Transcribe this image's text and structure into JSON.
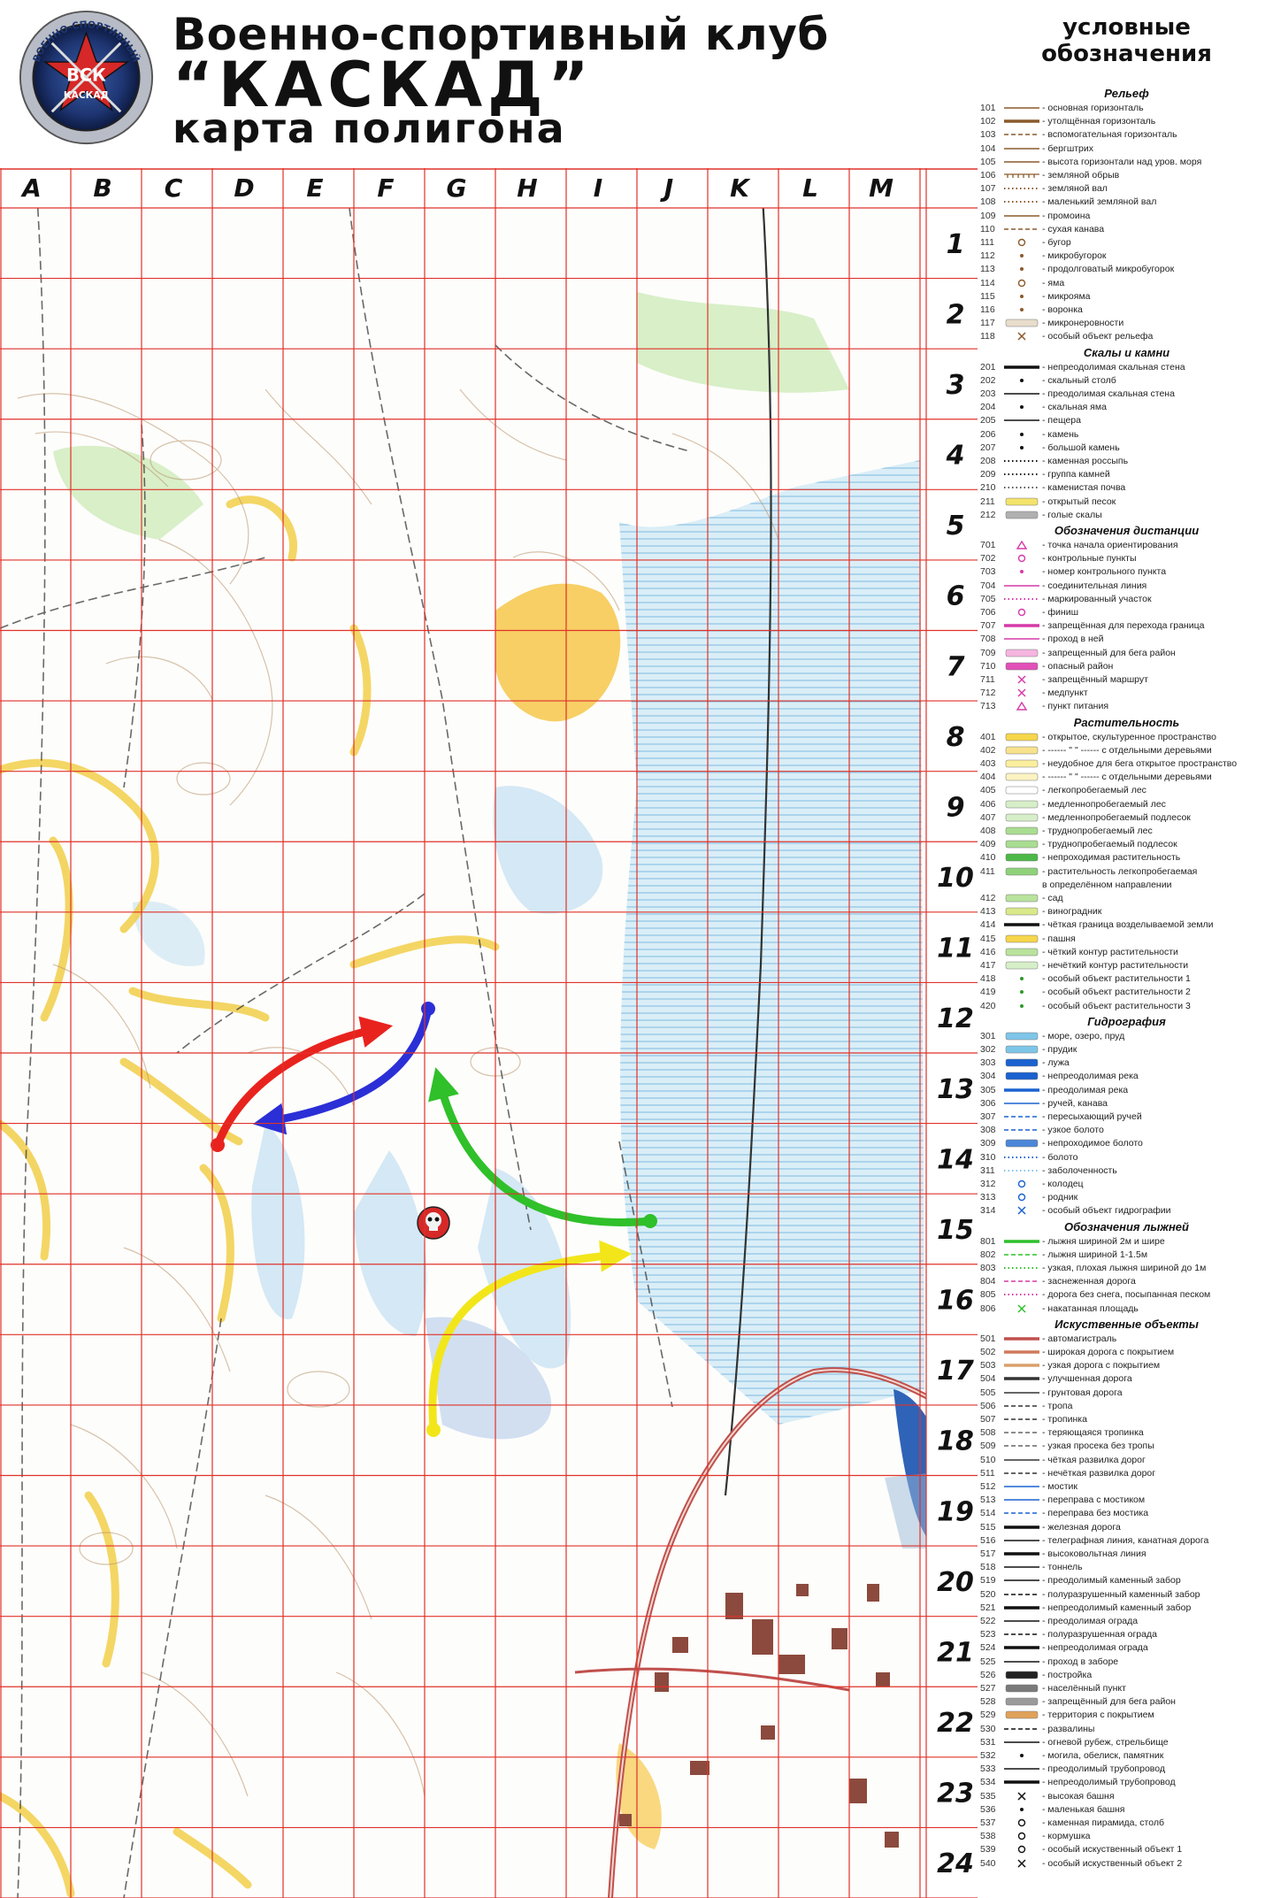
{
  "header": {
    "line1": "Военно-спортивный клуб",
    "line2": "“КАСКАД”",
    "line3": "карта полигона",
    "logo": {
      "top_text": "ВОЕННО-СПОРТИВНЫЙ",
      "abbr": "ВСК",
      "name": "КАСКАД"
    }
  },
  "grid": {
    "columns": [
      "A",
      "B",
      "C",
      "D",
      "E",
      "F",
      "G",
      "H",
      "I",
      "J",
      "K",
      "L",
      "M"
    ],
    "rows": [
      "1",
      "2",
      "3",
      "4",
      "5",
      "6",
      "7",
      "8",
      "9",
      "10",
      "11",
      "12",
      "13",
      "14",
      "15",
      "16",
      "17",
      "18",
      "19",
      "20",
      "21",
      "22",
      "23",
      "24"
    ]
  },
  "routes": [
    {
      "color": "#e8231e",
      "name": "red"
    },
    {
      "color": "#2b2fd6",
      "name": "blue"
    },
    {
      "color": "#2fc02a",
      "name": "green"
    },
    {
      "color": "#f2e61b",
      "name": "yellow"
    }
  ],
  "legend": {
    "title_line1": "условные",
    "title_line2": "обозначения",
    "sections": [
      {
        "title": "Рельеф",
        "items": [
          [
            "101",
            "основная горизонталь",
            "line",
            "#8a5a2b"
          ],
          [
            "102",
            "утолщённая горизонталь",
            "thick",
            "#8a5a2b"
          ],
          [
            "103",
            "вспомогательная горизонталь",
            "dash",
            "#8a5a2b"
          ],
          [
            "104",
            "бергштрих",
            "line",
            "#8a5a2b"
          ],
          [
            "105",
            "высота горизонтали над уров. моря",
            "line",
            "#8a5a2b"
          ],
          [
            "106",
            "земляной обрыв",
            "comb",
            "#8a5a2b"
          ],
          [
            "107",
            "земляной вал",
            "dots",
            "#8a5a2b"
          ],
          [
            "108",
            "маленький земляной вал",
            "dots",
            "#8a5a2b"
          ],
          [
            "109",
            "промоина",
            "line",
            "#8a5a2b"
          ],
          [
            "110",
            "сухая канава",
            "dash",
            "#8a5a2b"
          ],
          [
            "111",
            "бугор",
            "ring",
            "#8a5a2b"
          ],
          [
            "112",
            "микробугорок",
            "dot",
            "#8a5a2b"
          ],
          [
            "113",
            "продолговатый микробугорок",
            "dot",
            "#8a5a2b"
          ],
          [
            "114",
            "яма",
            "ring",
            "#8a5a2b"
          ],
          [
            "115",
            "микрояма",
            "dot",
            "#8a5a2b"
          ],
          [
            "116",
            "воронка",
            "dot",
            "#8a5a2b"
          ],
          [
            "117",
            "микронеровности",
            "fill",
            "#e8dccb"
          ],
          [
            "118",
            "особый объект рельефа",
            "cross",
            "#8a5a2b"
          ]
        ]
      },
      {
        "title": "Скалы и камни",
        "items": [
          [
            "201",
            "непреодолимая скальная стена",
            "thick",
            "#111111"
          ],
          [
            "202",
            "скальный столб",
            "dot",
            "#111111"
          ],
          [
            "203",
            "преодолимая скальная стена",
            "line",
            "#111111"
          ],
          [
            "204",
            "скальная яма",
            "dot",
            "#111111"
          ],
          [
            "205",
            "пещера",
            "line",
            "#111111"
          ],
          [
            "206",
            "камень",
            "dot",
            "#111111"
          ],
          [
            "207",
            "большой камень",
            "dot",
            "#111111"
          ],
          [
            "208",
            "каменная россыпь",
            "dots",
            "#111111"
          ],
          [
            "209",
            "группа камней",
            "dots",
            "#111111"
          ],
          [
            "210",
            "каменистая почва",
            "dots",
            "#555555"
          ],
          [
            "211",
            "открытый песок",
            "fill",
            "#f4e36a"
          ],
          [
            "212",
            "голые скалы",
            "fill",
            "#b0b0b0"
          ]
        ]
      },
      {
        "title": "Обозначения дистанции",
        "items": [
          [
            "701",
            "точка начала ориентирования",
            "tri",
            "#d63aa8"
          ],
          [
            "702",
            "контрольные пункты",
            "ring",
            "#d63aa8"
          ],
          [
            "703",
            "номер контрольного пункта",
            "dot",
            "#d63aa8"
          ],
          [
            "704",
            "соединительная линия",
            "line",
            "#d63aa8"
          ],
          [
            "705",
            "маркированный участок",
            "dots",
            "#d63aa8"
          ],
          [
            "706",
            "финиш",
            "ring",
            "#d63aa8"
          ],
          [
            "707",
            "запрещённая для перехода граница",
            "thick",
            "#d63aa8"
          ],
          [
            "708",
            "проход в ней",
            "line",
            "#d63aa8"
          ],
          [
            "709",
            "запрещенный для бега район",
            "fill",
            "#f5b5df"
          ],
          [
            "710",
            "опасный район",
            "fill",
            "#e24fb8"
          ],
          [
            "711",
            "запрещённый маршрут",
            "cross",
            "#d63aa8"
          ],
          [
            "712",
            "медпункт",
            "cross",
            "#d63aa8"
          ],
          [
            "713",
            "пункт питания",
            "tri",
            "#d63aa8"
          ]
        ]
      },
      {
        "title": "Растительность",
        "items": [
          [
            "401",
            "открытое, скультуренное пространство",
            "fill",
            "#f6d64a"
          ],
          [
            "402",
            "------ \" \" ------ с отдельными деревьями",
            "fill",
            "#f8e28c"
          ],
          [
            "403",
            "неудобное для бега открытое пространство",
            "fill",
            "#fbef9e"
          ],
          [
            "404",
            "------ \" \" ------ с отдельными деревьями",
            "fill",
            "#fcf3c2"
          ],
          [
            "405",
            "легкопробегаемый лес",
            "fill",
            "#ffffff"
          ],
          [
            "406",
            "медленнопробегаемый лес",
            "fill",
            "#d6efc9"
          ],
          [
            "407",
            "медленнопробегаемый подлесок",
            "fill",
            "#d6efc9"
          ],
          [
            "408",
            "труднопробегаемый лес",
            "fill",
            "#a9dd91"
          ],
          [
            "409",
            "труднопробегаемый подлесок",
            "fill",
            "#a9dd91"
          ],
          [
            "410",
            "непроходимая растительность",
            "fill",
            "#4cb847"
          ],
          [
            "411",
            "растительность легкопробегаемая",
            "fill",
            "#8fd27a"
          ],
          [
            "",
            "в определённом направлении",
            "none",
            ""
          ],
          [
            "412",
            "сад",
            "fill",
            "#b9e39d"
          ],
          [
            "413",
            "виноградник",
            "fill",
            "#d9e98a"
          ],
          [
            "414",
            "чёткая граница возделываемой земли",
            "thick",
            "#111111"
          ],
          [
            "415",
            "пашня",
            "fill",
            "#f6d64a"
          ],
          [
            "416",
            "чёткий контур растительности",
            "fill",
            "#b9e39d"
          ],
          [
            "417",
            "нечёткий контур растительности",
            "fill",
            "#d6efc9"
          ],
          [
            "418",
            "особый объект растительности 1",
            "dot",
            "#2f9a2a"
          ],
          [
            "419",
            "особый объект растительности 2",
            "dot",
            "#2f9a2a"
          ],
          [
            "420",
            "особый объект растительности 3",
            "dot",
            "#2f9a2a"
          ]
        ]
      },
      {
        "title": "Гидрография",
        "items": [
          [
            "301",
            "море, озеро, пруд",
            "fill",
            "#7ec6e8"
          ],
          [
            "302",
            "прудик",
            "fill",
            "#7ec6e8"
          ],
          [
            "303",
            "лужа",
            "fill",
            "#1a62d0"
          ],
          [
            "304",
            "непреодолимая река",
            "fill",
            "#1a62d0"
          ],
          [
            "305",
            "преодолимая река",
            "thick",
            "#1a62d0"
          ],
          [
            "306",
            "ручей, канава",
            "line",
            "#1a62d0"
          ],
          [
            "307",
            "пересыхающий ручей",
            "dash",
            "#1a62d0"
          ],
          [
            "308",
            "узкое болото",
            "dash",
            "#1a62d0"
          ],
          [
            "309",
            "непроходимое болото",
            "fill",
            "#4c86d8"
          ],
          [
            "310",
            "болото",
            "dots",
            "#1a62d0"
          ],
          [
            "311",
            "заболоченность",
            "dots",
            "#7ec6e8"
          ],
          [
            "312",
            "колодец",
            "ring",
            "#1a62d0"
          ],
          [
            "313",
            "родник",
            "ring",
            "#1a62d0"
          ],
          [
            "314",
            "особый объект гидрографии",
            "cross",
            "#1a62d0"
          ]
        ]
      },
      {
        "title": "Обозначения лыжней",
        "items": [
          [
            "801",
            "лыжня шириной 2м и шире",
            "thick",
            "#2fc02a"
          ],
          [
            "802",
            "лыжня шириной 1-1.5м",
            "dash",
            "#2fc02a"
          ],
          [
            "803",
            "узкая, плохая лыжня шириной до 1м",
            "dots",
            "#2fc02a"
          ],
          [
            "804",
            "заснеженная дорога",
            "dash",
            "#d63aa8"
          ],
          [
            "805",
            "дорога без снега, посыпанная песком",
            "dots",
            "#d63aa8"
          ],
          [
            "806",
            "накатанная площадь",
            "cross",
            "#2fc02a"
          ]
        ]
      },
      {
        "title": "Искуственные объекты",
        "items": [
          [
            "501",
            "автомагистраль",
            "thick",
            "#c0504d"
          ],
          [
            "502",
            "широкая дорога с покрытием",
            "thick",
            "#d07a5b"
          ],
          [
            "503",
            "узкая дорога с покрытием",
            "thick",
            "#d9a06a"
          ],
          [
            "504",
            "улучшенная дорога",
            "thick",
            "#333333"
          ],
          [
            "505",
            "грунтовая дорога",
            "line",
            "#333333"
          ],
          [
            "506",
            "тропа",
            "dash",
            "#333333"
          ],
          [
            "507",
            "тропинка",
            "dash",
            "#333333"
          ],
          [
            "508",
            "теряющаяся тропинка",
            "dash",
            "#666666"
          ],
          [
            "509",
            "узкая просека без тропы",
            "dash",
            "#666666"
          ],
          [
            "510",
            "чёткая развилка дорог",
            "line",
            "#333333"
          ],
          [
            "511",
            "нечёткая развилка дорог",
            "dash",
            "#333333"
          ],
          [
            "512",
            "мостик",
            "line",
            "#1a62d0"
          ],
          [
            "513",
            "переправа с мостиком",
            "line",
            "#1a62d0"
          ],
          [
            "514",
            "переправа без мостика",
            "dash",
            "#1a62d0"
          ],
          [
            "515",
            "железная дорога",
            "thick",
            "#111111"
          ],
          [
            "516",
            "телеграфная линия, канатная дорога",
            "line",
            "#111111"
          ],
          [
            "517",
            "высоковольтная линия",
            "thick",
            "#111111"
          ],
          [
            "518",
            "тоннель",
            "line",
            "#111111"
          ],
          [
            "519",
            "преодолимый каменный забор",
            "line",
            "#111111"
          ],
          [
            "520",
            "полуразрушенный каменный забор",
            "dash",
            "#111111"
          ],
          [
            "521",
            "непреодолимый каменный забор",
            "thick",
            "#111111"
          ],
          [
            "522",
            "преодолимая ограда",
            "line",
            "#111111"
          ],
          [
            "523",
            "полуразрушенная ограда",
            "dash",
            "#111111"
          ],
          [
            "524",
            "непреодолимая ограда",
            "thick",
            "#111111"
          ],
          [
            "525",
            "проход в заборе",
            "line",
            "#111111"
          ],
          [
            "526",
            "постройка",
            "fill",
            "#222222"
          ],
          [
            "527",
            "населённый пункт",
            "fill",
            "#7a7a7a"
          ],
          [
            "528",
            "запрещённый для бега район",
            "fill",
            "#9a9a9a"
          ],
          [
            "529",
            "территория с покрытием",
            "fill",
            "#e0a25a"
          ],
          [
            "530",
            "развалины",
            "dash",
            "#111111"
          ],
          [
            "531",
            "огневой рубеж, стрельбище",
            "line",
            "#111111"
          ],
          [
            "532",
            "могила, обелиск, памятник",
            "dot",
            "#111111"
          ],
          [
            "533",
            "преодолимый трубопровод",
            "line",
            "#111111"
          ],
          [
            "534",
            "непреодолимый трубопровод",
            "thick",
            "#111111"
          ],
          [
            "535",
            "высокая башня",
            "cross",
            "#111111"
          ],
          [
            "536",
            "маленькая башня",
            "dot",
            "#111111"
          ],
          [
            "537",
            "каменная пирамида, столб",
            "ring",
            "#111111"
          ],
          [
            "538",
            "кормушка",
            "ring",
            "#111111"
          ],
          [
            "539",
            "особый искуственный объект 1",
            "ring",
            "#111111"
          ],
          [
            "540",
            "особый искуственный объект 2",
            "cross",
            "#111111"
          ]
        ]
      }
    ]
  }
}
